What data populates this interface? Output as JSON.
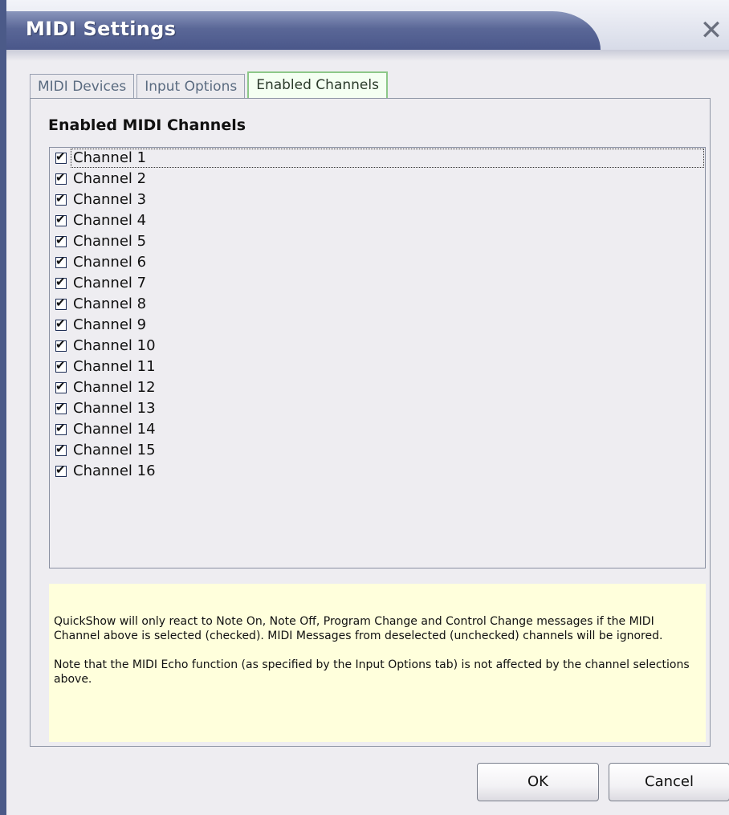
{
  "window": {
    "title": "MIDI Settings",
    "close_glyph": "✕"
  },
  "tabs": [
    {
      "label": "MIDI Devices",
      "active": false
    },
    {
      "label": "Input Options",
      "active": false
    },
    {
      "label": "Enabled Channels",
      "active": true
    }
  ],
  "enabled_channels": {
    "heading": "Enabled MIDI Channels",
    "channels": [
      {
        "label": "Channel 1",
        "checked": true
      },
      {
        "label": "Channel 2",
        "checked": true
      },
      {
        "label": "Channel 3",
        "checked": true
      },
      {
        "label": "Channel 4",
        "checked": true
      },
      {
        "label": "Channel 5",
        "checked": true
      },
      {
        "label": "Channel 6",
        "checked": true
      },
      {
        "label": "Channel 7",
        "checked": true
      },
      {
        "label": "Channel 8",
        "checked": true
      },
      {
        "label": "Channel 9",
        "checked": true
      },
      {
        "label": "Channel 10",
        "checked": true
      },
      {
        "label": "Channel 11",
        "checked": true
      },
      {
        "label": "Channel 12",
        "checked": true
      },
      {
        "label": "Channel 13",
        "checked": true
      },
      {
        "label": "Channel 14",
        "checked": true
      },
      {
        "label": "Channel 15",
        "checked": true
      },
      {
        "label": "Channel 16",
        "checked": true
      }
    ],
    "check_glyph": "✔"
  },
  "info": {
    "paragraph1": "QuickShow will only react to Note On, Note Off, Program Change and Control Change messages if the MIDI Channel above is selected (checked). MIDI Messages from  deselected (unchecked) channels will be ignored.",
    "paragraph2": "Note that the MIDI Echo function (as specified by the Input Options tab) is not affected by the channel selections above."
  },
  "buttons": {
    "ok_label": "OK",
    "cancel_label": "Cancel"
  },
  "colors": {
    "title_band": "#4a578a",
    "active_tab_border": "#8cc888",
    "info_background": "#ffffdc"
  },
  "icons": {
    "close": "close-icon",
    "check": "checkmark-icon"
  }
}
